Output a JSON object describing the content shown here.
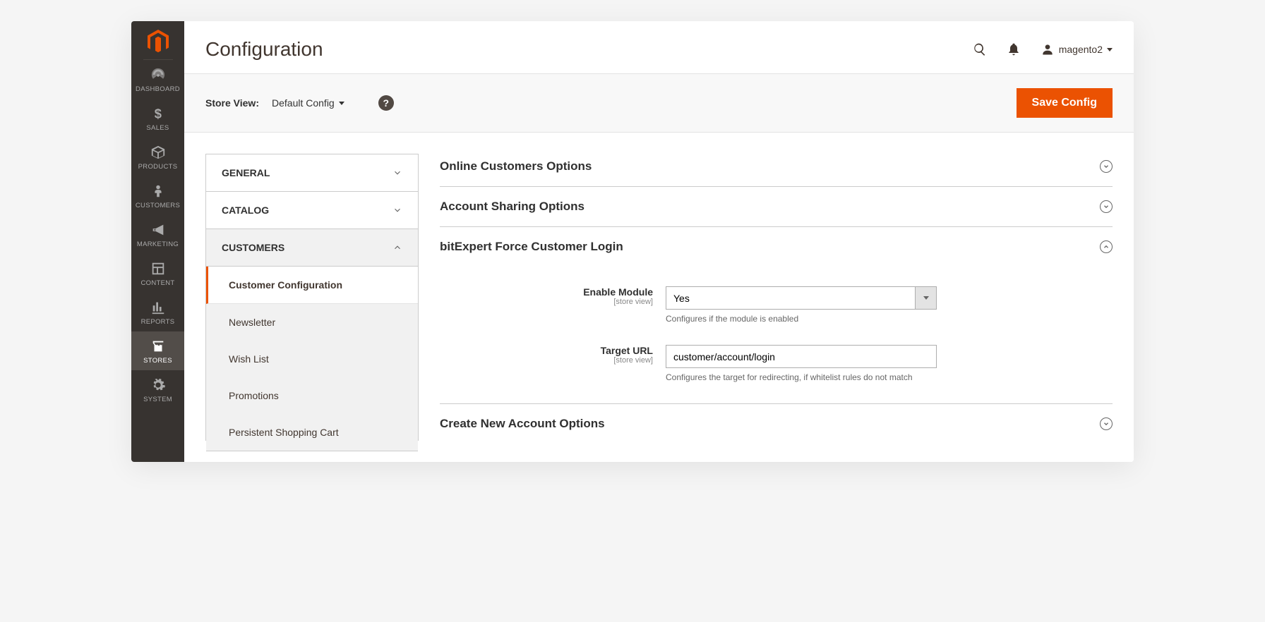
{
  "page_title": "Configuration",
  "user_name": "magento2",
  "toolbar": {
    "store_view_label": "Store View:",
    "store_view_value": "Default Config",
    "save_label": "Save Config"
  },
  "sidebar": {
    "items": [
      {
        "label": "DASHBOARD"
      },
      {
        "label": "SALES"
      },
      {
        "label": "PRODUCTS"
      },
      {
        "label": "CUSTOMERS"
      },
      {
        "label": "MARKETING"
      },
      {
        "label": "CONTENT"
      },
      {
        "label": "REPORTS"
      },
      {
        "label": "STORES"
      },
      {
        "label": "SYSTEM"
      }
    ]
  },
  "config_nav": {
    "tabs": [
      {
        "label": "GENERAL"
      },
      {
        "label": "CATALOG"
      },
      {
        "label": "CUSTOMERS"
      }
    ],
    "sub_items": [
      {
        "label": "Customer Configuration"
      },
      {
        "label": "Newsletter"
      },
      {
        "label": "Wish List"
      },
      {
        "label": "Promotions"
      },
      {
        "label": "Persistent Shopping Cart"
      }
    ]
  },
  "sections": {
    "online_customers": "Online Customers Options",
    "account_sharing": "Account Sharing Options",
    "force_login": "bitExpert Force Customer Login",
    "create_account": "Create New Account Options"
  },
  "form": {
    "enable_module": {
      "label": "Enable Module",
      "scope": "[store view]",
      "value": "Yes",
      "hint": "Configures if the module is enabled"
    },
    "target_url": {
      "label": "Target URL",
      "scope": "[store view]",
      "value": "customer/account/login",
      "hint": "Configures the target for redirecting, if whitelist rules do not match"
    }
  }
}
